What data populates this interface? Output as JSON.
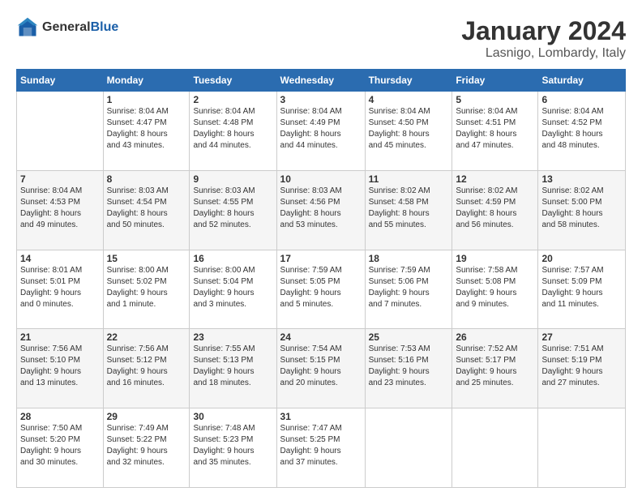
{
  "header": {
    "logo_line1": "General",
    "logo_line2": "Blue",
    "main_title": "January 2024",
    "subtitle": "Lasnigo, Lombardy, Italy"
  },
  "days_of_week": [
    "Sunday",
    "Monday",
    "Tuesday",
    "Wednesday",
    "Thursday",
    "Friday",
    "Saturday"
  ],
  "weeks": [
    [
      {
        "day": "",
        "detail": ""
      },
      {
        "day": "1",
        "detail": "Sunrise: 8:04 AM\nSunset: 4:47 PM\nDaylight: 8 hours\nand 43 minutes."
      },
      {
        "day": "2",
        "detail": "Sunrise: 8:04 AM\nSunset: 4:48 PM\nDaylight: 8 hours\nand 44 minutes."
      },
      {
        "day": "3",
        "detail": "Sunrise: 8:04 AM\nSunset: 4:49 PM\nDaylight: 8 hours\nand 44 minutes."
      },
      {
        "day": "4",
        "detail": "Sunrise: 8:04 AM\nSunset: 4:50 PM\nDaylight: 8 hours\nand 45 minutes."
      },
      {
        "day": "5",
        "detail": "Sunrise: 8:04 AM\nSunset: 4:51 PM\nDaylight: 8 hours\nand 47 minutes."
      },
      {
        "day": "6",
        "detail": "Sunrise: 8:04 AM\nSunset: 4:52 PM\nDaylight: 8 hours\nand 48 minutes."
      }
    ],
    [
      {
        "day": "7",
        "detail": "Sunrise: 8:04 AM\nSunset: 4:53 PM\nDaylight: 8 hours\nand 49 minutes."
      },
      {
        "day": "8",
        "detail": "Sunrise: 8:03 AM\nSunset: 4:54 PM\nDaylight: 8 hours\nand 50 minutes."
      },
      {
        "day": "9",
        "detail": "Sunrise: 8:03 AM\nSunset: 4:55 PM\nDaylight: 8 hours\nand 52 minutes."
      },
      {
        "day": "10",
        "detail": "Sunrise: 8:03 AM\nSunset: 4:56 PM\nDaylight: 8 hours\nand 53 minutes."
      },
      {
        "day": "11",
        "detail": "Sunrise: 8:02 AM\nSunset: 4:58 PM\nDaylight: 8 hours\nand 55 minutes."
      },
      {
        "day": "12",
        "detail": "Sunrise: 8:02 AM\nSunset: 4:59 PM\nDaylight: 8 hours\nand 56 minutes."
      },
      {
        "day": "13",
        "detail": "Sunrise: 8:02 AM\nSunset: 5:00 PM\nDaylight: 8 hours\nand 58 minutes."
      }
    ],
    [
      {
        "day": "14",
        "detail": "Sunrise: 8:01 AM\nSunset: 5:01 PM\nDaylight: 9 hours\nand 0 minutes."
      },
      {
        "day": "15",
        "detail": "Sunrise: 8:00 AM\nSunset: 5:02 PM\nDaylight: 9 hours\nand 1 minute."
      },
      {
        "day": "16",
        "detail": "Sunrise: 8:00 AM\nSunset: 5:04 PM\nDaylight: 9 hours\nand 3 minutes."
      },
      {
        "day": "17",
        "detail": "Sunrise: 7:59 AM\nSunset: 5:05 PM\nDaylight: 9 hours\nand 5 minutes."
      },
      {
        "day": "18",
        "detail": "Sunrise: 7:59 AM\nSunset: 5:06 PM\nDaylight: 9 hours\nand 7 minutes."
      },
      {
        "day": "19",
        "detail": "Sunrise: 7:58 AM\nSunset: 5:08 PM\nDaylight: 9 hours\nand 9 minutes."
      },
      {
        "day": "20",
        "detail": "Sunrise: 7:57 AM\nSunset: 5:09 PM\nDaylight: 9 hours\nand 11 minutes."
      }
    ],
    [
      {
        "day": "21",
        "detail": "Sunrise: 7:56 AM\nSunset: 5:10 PM\nDaylight: 9 hours\nand 13 minutes."
      },
      {
        "day": "22",
        "detail": "Sunrise: 7:56 AM\nSunset: 5:12 PM\nDaylight: 9 hours\nand 16 minutes."
      },
      {
        "day": "23",
        "detail": "Sunrise: 7:55 AM\nSunset: 5:13 PM\nDaylight: 9 hours\nand 18 minutes."
      },
      {
        "day": "24",
        "detail": "Sunrise: 7:54 AM\nSunset: 5:15 PM\nDaylight: 9 hours\nand 20 minutes."
      },
      {
        "day": "25",
        "detail": "Sunrise: 7:53 AM\nSunset: 5:16 PM\nDaylight: 9 hours\nand 23 minutes."
      },
      {
        "day": "26",
        "detail": "Sunrise: 7:52 AM\nSunset: 5:17 PM\nDaylight: 9 hours\nand 25 minutes."
      },
      {
        "day": "27",
        "detail": "Sunrise: 7:51 AM\nSunset: 5:19 PM\nDaylight: 9 hours\nand 27 minutes."
      }
    ],
    [
      {
        "day": "28",
        "detail": "Sunrise: 7:50 AM\nSunset: 5:20 PM\nDaylight: 9 hours\nand 30 minutes."
      },
      {
        "day": "29",
        "detail": "Sunrise: 7:49 AM\nSunset: 5:22 PM\nDaylight: 9 hours\nand 32 minutes."
      },
      {
        "day": "30",
        "detail": "Sunrise: 7:48 AM\nSunset: 5:23 PM\nDaylight: 9 hours\nand 35 minutes."
      },
      {
        "day": "31",
        "detail": "Sunrise: 7:47 AM\nSunset: 5:25 PM\nDaylight: 9 hours\nand 37 minutes."
      },
      {
        "day": "",
        "detail": ""
      },
      {
        "day": "",
        "detail": ""
      },
      {
        "day": "",
        "detail": ""
      }
    ]
  ]
}
